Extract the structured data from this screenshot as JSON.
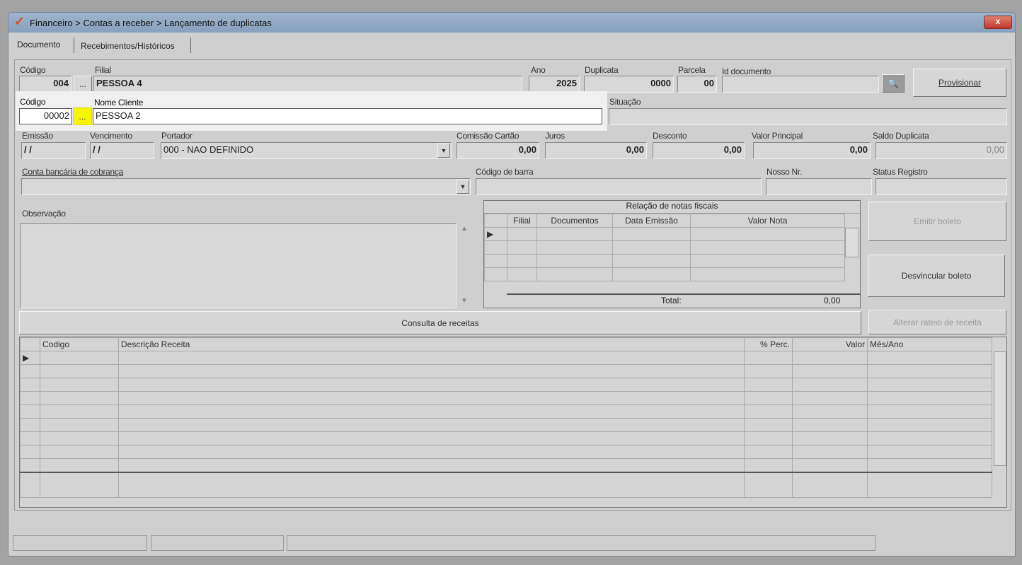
{
  "window": {
    "title": "Financeiro > Contas a receber > Lançamento de duplicatas",
    "close": "x"
  },
  "tabs": [
    {
      "label": "Documento"
    },
    {
      "label": "Recebimentos/Históricos"
    }
  ],
  "filial": {
    "codigo_label": "Código",
    "codigo": "004",
    "nome_label": "Filial",
    "nome": "PESSOA 4",
    "browse": "..."
  },
  "ano": {
    "label": "Ano",
    "value": "2025"
  },
  "duplicata": {
    "label": "Duplicata",
    "value": "0000"
  },
  "parcela": {
    "label": "Parcela",
    "value": "00"
  },
  "id_documento": {
    "label": "Id documento",
    "value": ""
  },
  "provisionar": "Provisionar",
  "cliente": {
    "codigo_label": "Código",
    "codigo": "00002",
    "browse": "...",
    "nome_label": "Nome Cliente",
    "nome": "PESSOA 2"
  },
  "situacao": {
    "label": "Situação",
    "value": ""
  },
  "emissao": {
    "label": "Emissão",
    "value": "/ /"
  },
  "vencimento": {
    "label": "Vencimento",
    "value": "/ /"
  },
  "portador": {
    "label": "Portador",
    "value": "000 - NAO DEFINIDO"
  },
  "comissao": {
    "label": "Comissão Cartão",
    "value": "0,00"
  },
  "juros": {
    "label": "Juros",
    "value": "0,00"
  },
  "desconto": {
    "label": "Desconto",
    "value": "0,00"
  },
  "valor_principal": {
    "label": "Valor Principal",
    "value": "0,00"
  },
  "saldo": {
    "label": "Saldo Duplicata",
    "value": "0,00"
  },
  "conta": {
    "label": "Conta bancária de cobrança",
    "value": ""
  },
  "codigo_barra": {
    "label": "Código de barra",
    "value": ""
  },
  "nosso_nr": {
    "label": "Nosso Nr.",
    "value": ""
  },
  "status_registro": {
    "label": "Status Registro",
    "value": ""
  },
  "observacao": {
    "label": "Observação",
    "value": ""
  },
  "notas": {
    "title": "Relação de notas fiscais",
    "columns": [
      "Filial",
      "Documentos",
      "Data Emissão",
      "Valor Nota"
    ],
    "total_label": "Total:",
    "total": "0,00"
  },
  "buttons": {
    "emitir": "Emitir boleto",
    "desvincular": "Desvincular boleto",
    "consulta": "Consulta de receitas",
    "alterar": "Alterar rateio de receita"
  },
  "receitas": {
    "columns": [
      "Codigo",
      "Descrição Receita",
      "% Perc.",
      "Valor",
      "Mês/Ano"
    ]
  }
}
